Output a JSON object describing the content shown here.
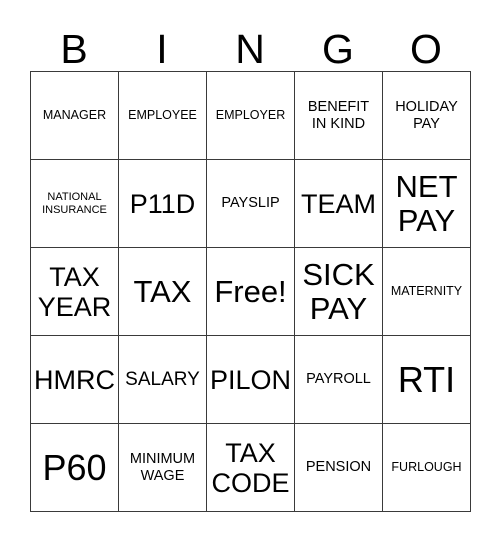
{
  "card": {
    "header_letters": [
      "B",
      "I",
      "N",
      "G",
      "O"
    ],
    "rows": [
      [
        {
          "label": "MANAGER",
          "size": "s"
        },
        {
          "label": "EMPLOYEE",
          "size": "s"
        },
        {
          "label": "EMPLOYER",
          "size": "s"
        },
        {
          "label": "BENEFIT\nIN KIND",
          "size": "m"
        },
        {
          "label": "HOLIDAY\nPAY",
          "size": "m"
        }
      ],
      [
        {
          "label": "NATIONAL\nINSURANCE",
          "size": "xs"
        },
        {
          "label": "P11D",
          "size": "xl"
        },
        {
          "label": "PAYSLIP",
          "size": "m"
        },
        {
          "label": "TEAM",
          "size": "xl"
        },
        {
          "label": "NET\nPAY",
          "size": "xxl"
        }
      ],
      [
        {
          "label": "TAX\nYEAR",
          "size": "xl"
        },
        {
          "label": "TAX",
          "size": "xxl"
        },
        {
          "label": "Free!",
          "size": "xxl"
        },
        {
          "label": "SICK\nPAY",
          "size": "xxl"
        },
        {
          "label": "MATERNITY",
          "size": "s"
        }
      ],
      [
        {
          "label": "HMRC",
          "size": "xl"
        },
        {
          "label": "SALARY",
          "size": "l"
        },
        {
          "label": "PILON",
          "size": "xl"
        },
        {
          "label": "PAYROLL",
          "size": "m"
        },
        {
          "label": "RTI",
          "size": "huge"
        }
      ],
      [
        {
          "label": "P60",
          "size": "huge"
        },
        {
          "label": "MINIMUM\nWAGE",
          "size": "m"
        },
        {
          "label": "TAX\nCODE",
          "size": "xl"
        },
        {
          "label": "PENSION",
          "size": "m"
        },
        {
          "label": "FURLOUGH",
          "size": "s"
        }
      ]
    ]
  },
  "colors": {
    "border": "#3a3a3a",
    "text": "#000000",
    "background": "#ffffff"
  }
}
